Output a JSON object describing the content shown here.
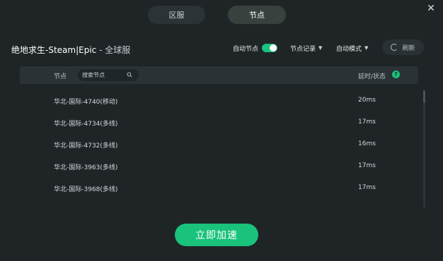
{
  "tabs": [
    {
      "label": "区服"
    },
    {
      "label": "节点"
    }
  ],
  "header": {
    "title": "绝地求生-Steam|Epic",
    "separator": " - ",
    "subtitle": "全球服"
  },
  "controls": {
    "auto_node_label": "自动节点",
    "auto_node_on": true,
    "history_label": "节点记录",
    "mode_label": "自动模式",
    "refresh_label": "刷新"
  },
  "table": {
    "col_node": "节点",
    "search_placeholder": "搜索节点",
    "col_status": "延时/状态",
    "help": "?",
    "rows": [
      {
        "name": "华北-国际-4740(移动)",
        "ping": "20ms"
      },
      {
        "name": "华北-国际-4734(多线)",
        "ping": "17ms"
      },
      {
        "name": "华北-国际-4732(多线)",
        "ping": "16ms"
      },
      {
        "name": "华北-国际-3963(多线)",
        "ping": "17ms"
      },
      {
        "name": "华北-国际-3968(多线)",
        "ping": "17ms"
      }
    ]
  },
  "action": {
    "accelerate_label": "立即加速"
  },
  "colors": {
    "accent": "#19c37b",
    "background": "#1f2527"
  }
}
